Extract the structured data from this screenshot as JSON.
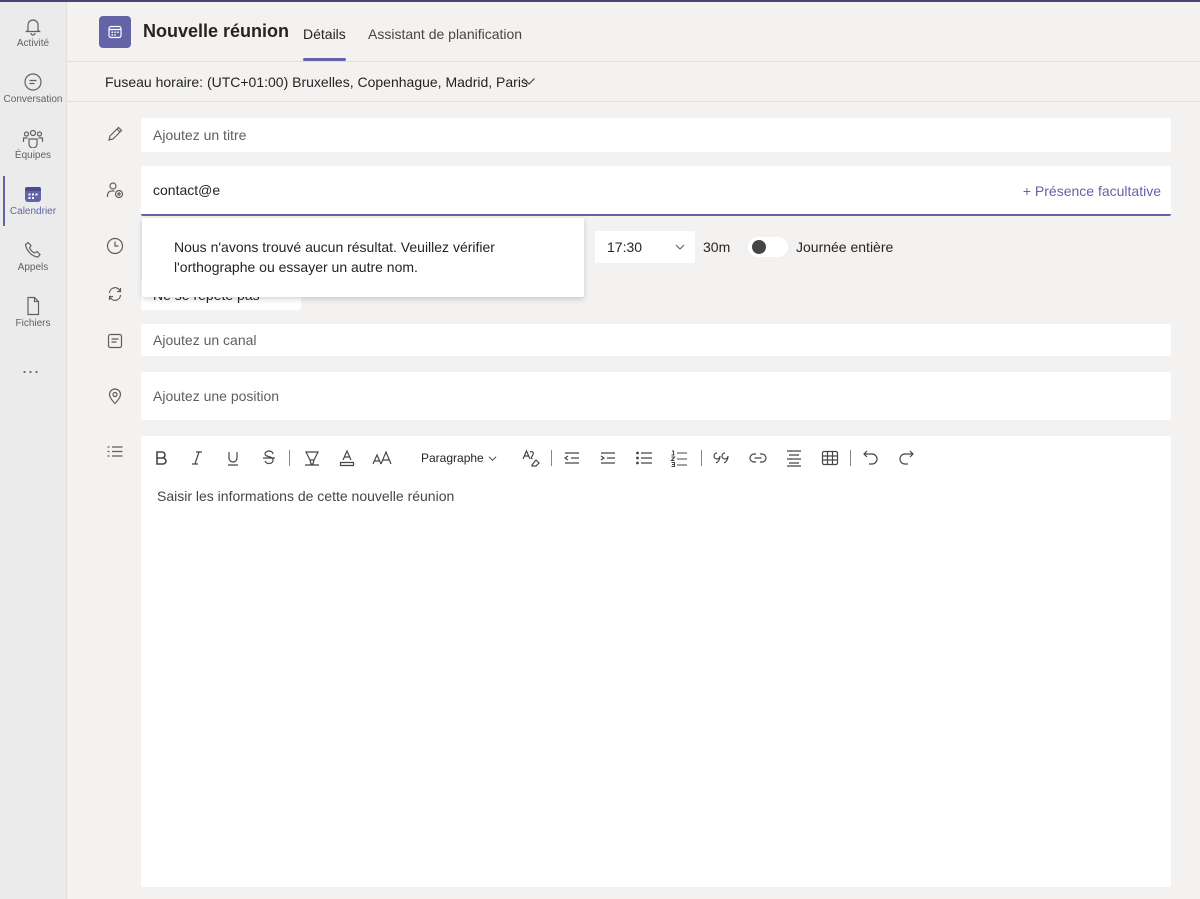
{
  "app_bar": {
    "items": [
      {
        "label": "Activité",
        "icon": "bell-icon"
      },
      {
        "label": "Conversation",
        "icon": "chat-icon"
      },
      {
        "label": "Équipes",
        "icon": "teams-icon"
      },
      {
        "label": "Calendrier",
        "icon": "calendar-icon",
        "active": true
      },
      {
        "label": "Appels",
        "icon": "phone-icon"
      },
      {
        "label": "Fichiers",
        "icon": "file-icon"
      }
    ],
    "more": "..."
  },
  "header": {
    "title": "Nouvelle réunion",
    "tabs": [
      {
        "label": "Détails",
        "active": true
      },
      {
        "label": "Assistant de planification"
      }
    ]
  },
  "timezone": {
    "text": "Fuseau horaire: (UTC+01:00) Bruxelles, Copenhague, Madrid, Paris"
  },
  "form": {
    "title_placeholder": "Ajoutez un titre",
    "attendee_value": "contact@e",
    "optional_label": "+ Présence facultative",
    "end_time": "17:30",
    "duration": "30m",
    "all_day_label": "Journée entière",
    "all_day_on": false,
    "recurrence": "Ne se répète pas",
    "channel_placeholder": "Ajoutez un canal",
    "location_placeholder": "Ajoutez une position"
  },
  "popup": {
    "message": "Nous n'avons trouvé aucun résultat. Veuillez vérifier l'orthographe ou essayer un autre nom."
  },
  "editor": {
    "paragraph_label": "Paragraphe",
    "placeholder": "Saisir les informations de cette nouvelle réunion"
  },
  "colors": {
    "accent": "#6264a7",
    "background": "#f3f2f1",
    "field": "#ffffff"
  }
}
